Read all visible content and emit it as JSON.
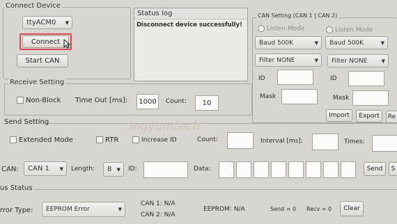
{
  "connect_device": {
    "title": "Connect Device",
    "port_value": "ttyACM0",
    "connect_label": "Connect",
    "start_can_label": "Start CAN"
  },
  "status_log": {
    "title": "Status log",
    "message": "Disconnect device successfully!"
  },
  "can_setting": {
    "title": "CAN Setting (CAN 1 | CAN 2)",
    "listen_mode_label": "Listen Mode",
    "baud_1": "Baud 500K",
    "baud_2": "Baud 500K",
    "filter_1": "Filter NONE",
    "filter_2": "Filter NONE",
    "id_label": "ID",
    "mask_label": "Mask",
    "import_label": "Import",
    "export_label": "Export",
    "re_label": "Re"
  },
  "receive_setting": {
    "title": "Receive Setting",
    "non_block_label": "Non-Block",
    "timeout_label": "Time Out [ms]:",
    "timeout_value": "1000",
    "count_label": "Count:",
    "count_value": "10"
  },
  "send_setting": {
    "title": "Send Setting",
    "extended_mode_label": "Extended Mode",
    "rtr_label": "RTR",
    "increase_id_label": "Increase ID",
    "count_label": "Count:",
    "interval_label": "Interval [ms]:",
    "times_label": "Times:",
    "can_label": "CAN:",
    "can_value": "CAN 1",
    "length_label": "Length:",
    "length_value": "8",
    "id_label": "ID:",
    "data_label": "Data:",
    "send_label": "Send",
    "s_label": "S"
  },
  "bus_status": {
    "title": "us Status",
    "error_type_label": "rror Type:",
    "error_type_value": "EEPROM Error",
    "can1": "CAN 1:  N/A",
    "can2": "CAN 2:  N/A",
    "eeprom": "EEPROM:  N/A",
    "send_count": "Send = 0",
    "recv_count": "Recv = 0",
    "clear_label": "Clear"
  },
  "watermark": "Ingyumtech",
  "colors": {
    "connect_highlight": "#e0464f",
    "background": "#d8d6d1"
  }
}
